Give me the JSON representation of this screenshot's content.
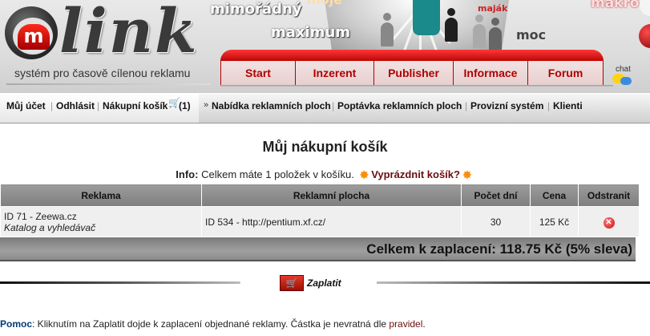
{
  "header": {
    "logo_letter": "m",
    "logo_word": "link",
    "tagline": "systém pro časově cílenou reklamu",
    "decor_words": {
      "mimoradny": "mimořádný",
      "maximum": "maximum",
      "moje": "moje",
      "majak": "maják",
      "moc": "moc",
      "makro": "makro"
    },
    "tabs": [
      {
        "label": "Start",
        "active": true
      },
      {
        "label": "Inzerent",
        "active": false
      },
      {
        "label": "Publisher",
        "active": false
      },
      {
        "label": "Informace",
        "active": false
      },
      {
        "label": "Forum",
        "active": false
      }
    ],
    "chat_label": "chat"
  },
  "nav": {
    "account": "Můj účet",
    "logout": "Odhlásit",
    "cart": "Nákupní košík",
    "cart_count": "(1)",
    "offers": "Nabídka reklamních ploch",
    "demands": "Poptávka reklamních ploch",
    "commission": "Provizní systém",
    "clients": "Klienti",
    "separator": "|",
    "arrow": "»"
  },
  "content": {
    "title": "Můj nákupní košík",
    "info_label": "Info:",
    "info_text": "Celkem máte 1 položek v košíku.",
    "empty_link": "Vyprázdnit košík?",
    "table": {
      "headers": [
        "Reklama",
        "Reklamní plocha",
        "Počet dní",
        "Cena",
        "Odstranit"
      ],
      "rows": [
        {
          "ad": "ID 71 - Zeewa.cz",
          "ad_sub": "Katalog a vyhledávač",
          "space": "ID 534 - http://pentium.xf.cz/",
          "days": "30",
          "price": "125 Kč"
        }
      ]
    },
    "total": "Celkem k zaplacení: 118.75 Kč (5% sleva)",
    "pay_label": "Zaplatit",
    "help_label": "Pomoc",
    "help_text": ": Kliknutím na Zaplatit dojde k zaplacení objednané reklamy. Částka je nevratná dle ",
    "help_link": "pravidel",
    "help_end": "."
  },
  "colors": {
    "brand_red": "#b00000",
    "link_dark_red": "#6a0e0e",
    "table_header": "#8c8c8c",
    "help_blue": "#003c78"
  }
}
